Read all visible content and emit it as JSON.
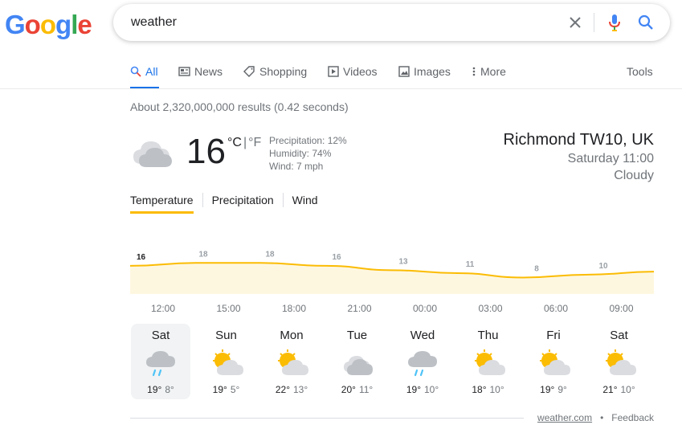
{
  "logo": {
    "letters": [
      "G",
      "o",
      "o",
      "g",
      "l",
      "e"
    ],
    "colors": [
      "#4285f4",
      "#ea4335",
      "#fbbc05",
      "#4285f4",
      "#34a853",
      "#ea4335"
    ]
  },
  "search": {
    "query": "weather",
    "clear_icon": "close-icon",
    "mic_icon": "mic-icon",
    "search_icon": "search-icon"
  },
  "tabs": {
    "all": "All",
    "news": "News",
    "shopping": "Shopping",
    "videos": "Videos",
    "images": "Images",
    "more": "More",
    "tools": "Tools"
  },
  "result_stats": "About 2,320,000,000 results (0.42 seconds)",
  "weather": {
    "current_temp": "16",
    "unit_c": "°C",
    "unit_sep": "|",
    "unit_f": "°F",
    "precipitation": "Precipitation: 12%",
    "humidity": "Humidity: 74%",
    "wind": "Wind: 7 mph",
    "location": "Richmond TW10, UK",
    "time": "Saturday 11:00",
    "condition": "Cloudy",
    "tabs": {
      "temperature": "Temperature",
      "precipitation": "Precipitation",
      "wind": "Wind"
    },
    "hourly_labels": [
      "12:00",
      "15:00",
      "18:00",
      "21:00",
      "00:00",
      "03:00",
      "06:00",
      "09:00"
    ],
    "hourly_temps": [
      16,
      18,
      18,
      16,
      13,
      11,
      8,
      10
    ],
    "days": [
      {
        "name": "Sat",
        "hi": "19°",
        "lo": "8°",
        "icon": "rain-cloud"
      },
      {
        "name": "Sun",
        "hi": "19°",
        "lo": "5°",
        "icon": "partly-cloudy"
      },
      {
        "name": "Mon",
        "hi": "22°",
        "lo": "13°",
        "icon": "partly-cloudy"
      },
      {
        "name": "Tue",
        "hi": "20°",
        "lo": "11°",
        "icon": "cloudy"
      },
      {
        "name": "Wed",
        "hi": "19°",
        "lo": "10°",
        "icon": "rain-cloud"
      },
      {
        "name": "Thu",
        "hi": "18°",
        "lo": "10°",
        "icon": "partly-cloudy"
      },
      {
        "name": "Fri",
        "hi": "19°",
        "lo": "9°",
        "icon": "partly-cloudy"
      },
      {
        "name": "Sat",
        "hi": "21°",
        "lo": "10°",
        "icon": "partly-cloudy"
      }
    ],
    "source": "weather.com",
    "footer_sep": "•",
    "feedback": "Feedback",
    "accent": "#fbbc04"
  }
}
